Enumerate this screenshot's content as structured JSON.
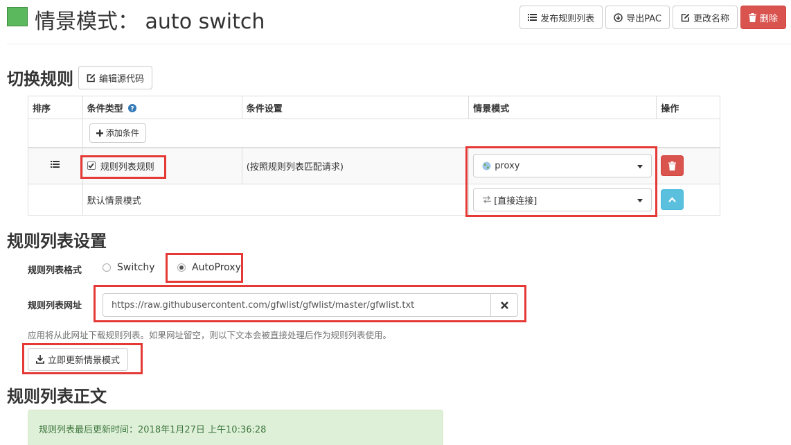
{
  "header": {
    "title": "情景模式： auto switch",
    "profile_color": "#5cb85c",
    "actions": {
      "publish_label": "发布规则列表",
      "export_label": "导出PAC",
      "rename_label": "更改名称",
      "delete_label": "删除"
    }
  },
  "switch_rules": {
    "title": "切换规则",
    "edit_source_label": "编辑源代码",
    "columns": {
      "order": "排序",
      "condition_type": "条件类型",
      "condition_settings": "条件设置",
      "profile": "情景模式",
      "actions": "操作"
    },
    "add_condition_label": "添加条件",
    "rows": [
      {
        "checked": true,
        "condition_type": "规则列表规则",
        "condition_settings": "(按照规则列表匹配请求)",
        "profile": "proxy"
      }
    ],
    "default_row": {
      "label": "默认情景模式",
      "profile": "[直接连接]"
    }
  },
  "rule_list_settings": {
    "title": "规则列表设置",
    "format_label": "规则列表格式",
    "format_options": [
      "Switchy",
      "AutoProxy"
    ],
    "format_selected": "AutoProxy",
    "url_label": "规则列表网址",
    "url_value": "https://raw.githubusercontent.com/gfwlist/gfwlist/master/gfwlist.txt",
    "help_text": "应用将从此网址下载规则列表。如果网址留空，则以下文本会被直接处理后作为规则列表使用。",
    "update_button_label": "立即更新情景模式"
  },
  "rule_list_text": {
    "title": "规则列表正文",
    "last_updated": "规则列表最后更新时间：2018年1月27日 上午10:36:28"
  },
  "colors": {
    "accent_danger": "#d9534f",
    "accent_info": "#5bc0de",
    "highlight": "#e53935",
    "success_bg": "#dff0d8"
  }
}
